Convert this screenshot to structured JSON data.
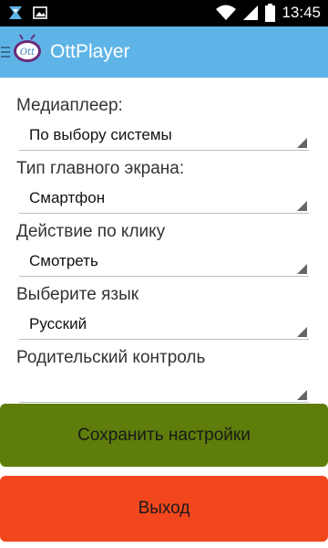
{
  "statusbar": {
    "time": "13:45",
    "icons": [
      "app-notification-icon",
      "image-notification-icon",
      "wifi-icon",
      "signal-icon",
      "battery-icon"
    ]
  },
  "actionbar": {
    "title": "OttPlayer",
    "logo_text": "Ott",
    "background": "#5fb4e7"
  },
  "settings": {
    "media_player": {
      "label": "Медиаплеер:",
      "value": "По выбору системы"
    },
    "main_screen_type": {
      "label": "Тип главного экрана:",
      "value": "Смартфон"
    },
    "click_action": {
      "label": "Действие по клику",
      "value": "Смотреть"
    },
    "language": {
      "label": "Выберите язык",
      "value": "Русский"
    },
    "parental_control": {
      "label": "Родительский контроль",
      "value": ""
    }
  },
  "buttons": {
    "save": {
      "label": "Сохранить настройки",
      "color": "#5e7d0b"
    },
    "exit": {
      "label": "Выход",
      "color": "#f2471c"
    }
  }
}
